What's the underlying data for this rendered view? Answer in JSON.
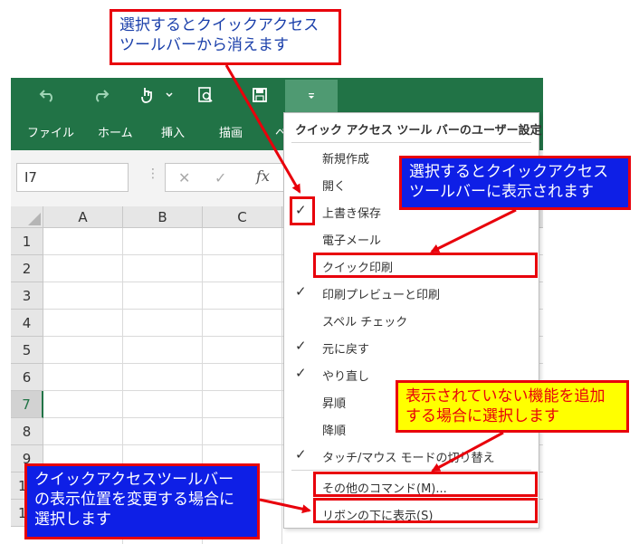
{
  "window": {
    "name_box": "I7",
    "tabs": [
      "ファイル",
      "ホーム",
      "挿入",
      "描画",
      "ペ"
    ]
  },
  "grid": {
    "columns": [
      "A",
      "B",
      "C"
    ],
    "rows": [
      "1",
      "2",
      "3",
      "4",
      "5",
      "6",
      "7",
      "8",
      "9",
      "10",
      "11"
    ],
    "selected_row": "7"
  },
  "menu": {
    "title": "クイック アクセス ツール バーのユーザー設定",
    "items": [
      {
        "label": "新規作成",
        "checked": false
      },
      {
        "label": "開く",
        "checked": false
      },
      {
        "label": "上書き保存",
        "checked": true
      },
      {
        "label": "電子メール",
        "checked": false
      },
      {
        "label": "クイック印刷",
        "checked": false
      },
      {
        "label": "印刷プレビューと印刷",
        "checked": true
      },
      {
        "label": "スペル チェック",
        "checked": false
      },
      {
        "label": "元に戻す",
        "checked": true
      },
      {
        "label": "やり直し",
        "checked": true
      },
      {
        "label": "昇順",
        "checked": false
      },
      {
        "label": "降順",
        "checked": false
      },
      {
        "label": "タッチ/マウス モードの切り替え",
        "checked": true
      }
    ],
    "more_commands": "その他のコマンド(M)...",
    "show_below": "リボンの下に表示(S)"
  },
  "annotations": {
    "remove_line1": "選択するとクイックアクセス",
    "remove_line2": "ツールバーから消えます",
    "add_line1": "選択するとクイックアクセス",
    "add_line2": "ツールバーに表示されます",
    "more_line1": "表示されていない機能を追加",
    "more_line2": "する場合に選択します",
    "position_line1": "クイックアクセスツールバー",
    "position_line2": "の表示位置を変更する場合に",
    "position_line3": "選択します"
  },
  "colors": {
    "excel_green": "#217346",
    "annotation_red": "#e8000b",
    "annotation_blue": "#0e1fe6",
    "annotation_yellow": "#ffff00"
  }
}
